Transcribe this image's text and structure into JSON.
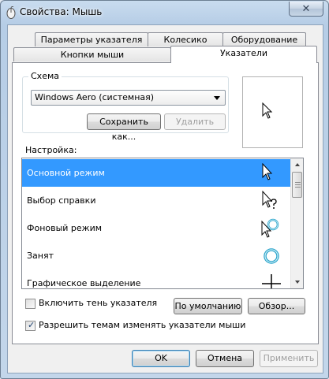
{
  "window": {
    "title": "Свойства: Мышь",
    "close_label": "✕"
  },
  "tabs": {
    "row1": [
      {
        "label": "Параметры указателя"
      },
      {
        "label": "Колесико"
      },
      {
        "label": "Оборудование"
      }
    ],
    "row2": [
      {
        "label": "Кнопки мыши"
      },
      {
        "label": "Указатели",
        "active": true
      }
    ]
  },
  "scheme": {
    "legend": "Схема",
    "selected": "Windows Aero (системная)",
    "save_as_label": "Сохранить как...",
    "delete_label": "Удалить"
  },
  "customize": {
    "label": "Настройка:",
    "items": [
      {
        "label": "Основной режим",
        "cursor": "arrow-cursor-icon",
        "selected": true
      },
      {
        "label": "Выбор справки",
        "cursor": "help-cursor-icon"
      },
      {
        "label": "Фоновый режим",
        "cursor": "working-in-background-cursor-icon"
      },
      {
        "label": "Занят",
        "cursor": "busy-cursor-icon"
      },
      {
        "label": "Графическое выделение",
        "cursor": "precision-select-cursor-icon"
      }
    ]
  },
  "options": {
    "shadow_label": "Включить тень указателя",
    "shadow_checked": false,
    "themes_label": "Разрешить темам изменять указатели мыши",
    "themes_checked": true,
    "default_label": "По умолчанию",
    "browse_label": "Обзор..."
  },
  "footer": {
    "ok_label": "OK",
    "cancel_label": "Отмена",
    "apply_label": "Применить"
  },
  "colors": {
    "selection": "#3399ff",
    "busy_ring": "#2aa3c9"
  }
}
